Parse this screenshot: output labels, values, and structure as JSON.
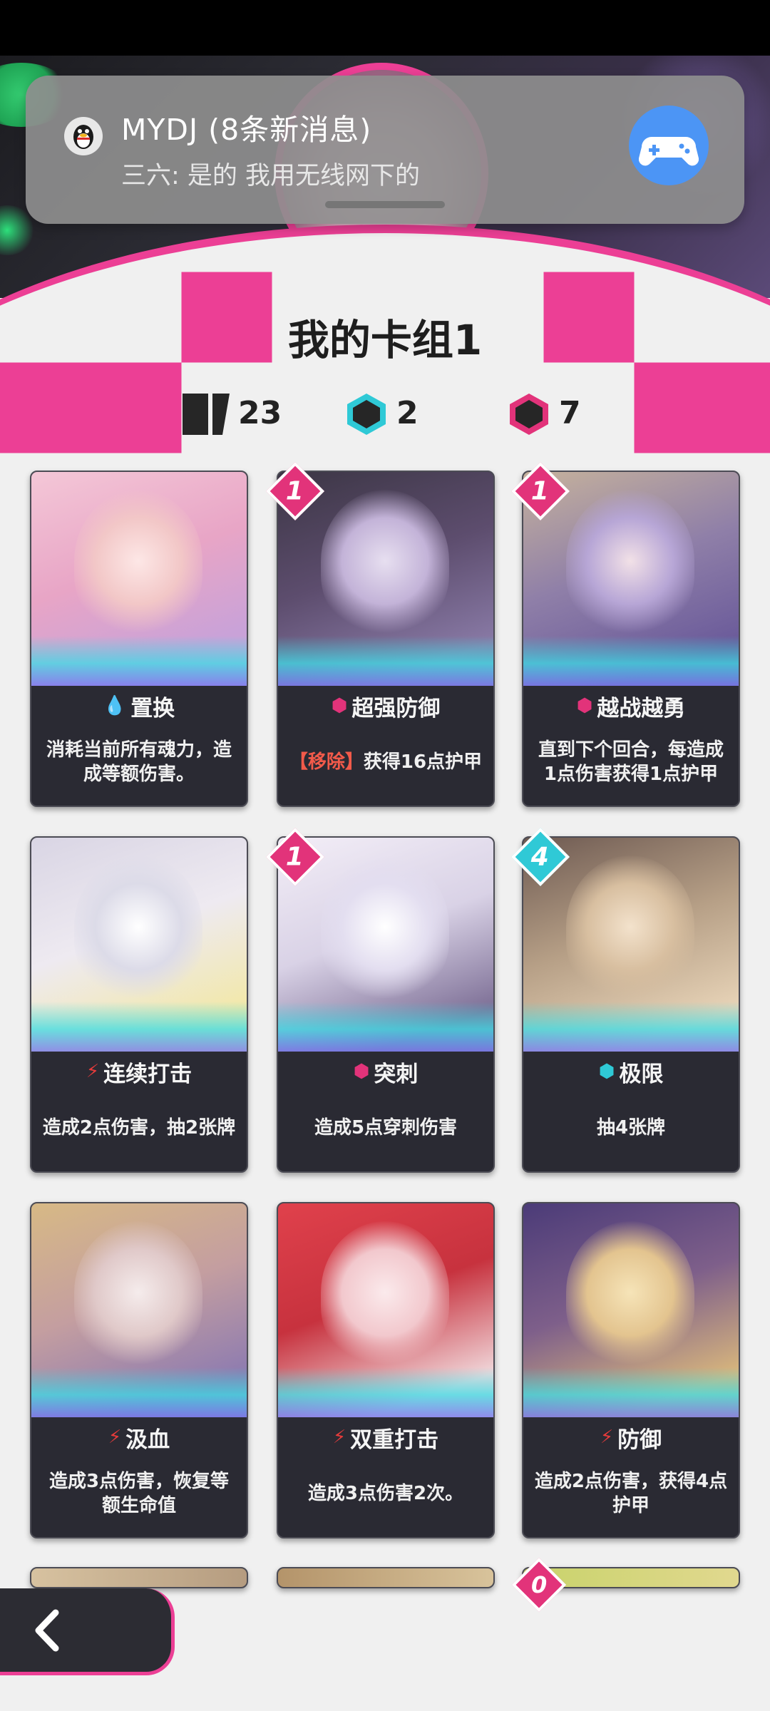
{
  "notification": {
    "title": "MYDJ (8条新消息)",
    "message": "三六: 是的 我用无线网下的",
    "app_icon": "qq-penguin-icon",
    "action_icon": "gamepad-icon"
  },
  "deck": {
    "title": "我的卡组1",
    "stats": [
      {
        "icon": "card-stack-icon",
        "value": "23"
      },
      {
        "icon": "cyan-hexagon-icon",
        "value": "2"
      },
      {
        "icon": "pink-hexagon-icon",
        "value": "7"
      }
    ]
  },
  "colors": {
    "accent": "#ec3f95",
    "cost_pink": "#e2337a",
    "cost_cyan": "#2fc9d6",
    "card_bg": "#2a2a33"
  },
  "cards": [
    {
      "name": "置换",
      "type_icon": "water-drop-icon",
      "desc": "消耗当前所有魂力，造成等额伤害。",
      "cost": ""
    },
    {
      "name": "超强防御",
      "type_icon": "pink-hexagon-icon",
      "desc_tag": "【移除】",
      "desc": "获得16点护甲",
      "cost": "1"
    },
    {
      "name": "越战越勇",
      "type_icon": "pink-hexagon-icon",
      "desc": "直到下个回合，每造成1点伤害获得1点护甲",
      "cost": "1"
    },
    {
      "name": "连续打击",
      "type_icon": "lightning-icon",
      "desc": "造成2点伤害，抽2张牌",
      "cost": ""
    },
    {
      "name": "突刺",
      "type_icon": "pink-hexagon-icon",
      "desc": "造成5点穿刺伤害",
      "cost": "1"
    },
    {
      "name": "极限",
      "type_icon": "cyan-hexagon-icon",
      "desc": "抽4张牌",
      "cost": "4"
    },
    {
      "name": "汲血",
      "type_icon": "lightning-icon",
      "desc": "造成3点伤害，恢复等额生命值",
      "cost": ""
    },
    {
      "name": "双重打击",
      "type_icon": "lightning-icon",
      "desc": "造成3点伤害2次。",
      "cost": ""
    },
    {
      "name": "防御",
      "type_icon": "lightning-icon",
      "desc": "造成2点伤害，获得4点护甲",
      "cost": ""
    }
  ],
  "partial_row_cost": "0",
  "back_icon": "chevron-left-icon"
}
